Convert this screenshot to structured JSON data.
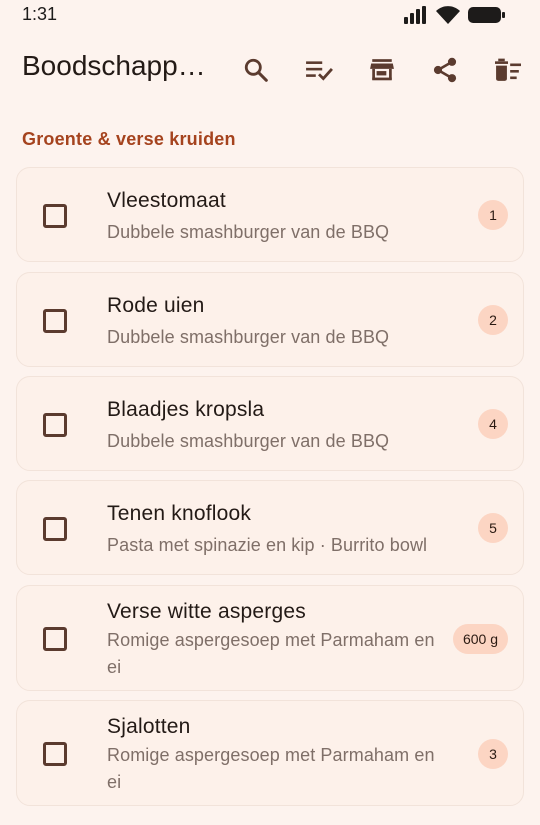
{
  "status_bar": {
    "time": "1:31",
    "icons": [
      "signal-icon",
      "wifi-icon",
      "battery-icon"
    ]
  },
  "app_bar": {
    "title": "Boodschapp…",
    "actions": [
      "search-icon",
      "checklist-icon",
      "store-icon",
      "share-icon",
      "delete-sweep-icon"
    ]
  },
  "section": {
    "title": "Groente & verse kruiden"
  },
  "items": [
    {
      "name": "Vleestomaat",
      "subtitle": "Dubbele smashburger van de BBQ",
      "badge": "1",
      "checked": false
    },
    {
      "name": "Rode uien",
      "subtitle": "Dubbele smashburger van de BBQ",
      "badge": "2",
      "checked": false
    },
    {
      "name": "Blaadjes kropsla",
      "subtitle": "Dubbele smashburger van de BBQ",
      "badge": "4",
      "checked": false
    },
    {
      "name": "Tenen knoflook",
      "subtitle": "Pasta met spinazie en kip · Burrito bowl",
      "badge": "5",
      "checked": false
    },
    {
      "name": "Verse witte asperges",
      "subtitle": "Romige aspergesoep met Parmaham en ei",
      "badge": "600 g",
      "checked": false
    },
    {
      "name": "Sjalotten",
      "subtitle": "Romige aspergesoep met Parmaham en ei",
      "badge": "3",
      "checked": false
    }
  ],
  "colors": {
    "background": "#fdf3ee",
    "accent": "#a5431e",
    "badge": "#fcd5c3",
    "icon": "#5b3b2f"
  }
}
